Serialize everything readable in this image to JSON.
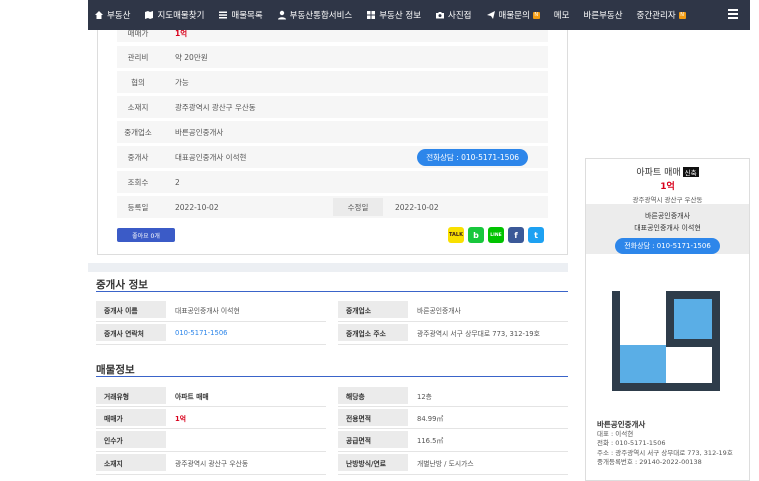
{
  "nav": {
    "items": [
      {
        "label": "부동산",
        "icon": "home-icon"
      },
      {
        "label": "지도매물찾기",
        "icon": "map-icon"
      },
      {
        "label": "매물목록",
        "icon": "list-icon"
      },
      {
        "label": "부동산통합서비스",
        "icon": "user-icon"
      },
      {
        "label": "부동산 정보",
        "icon": "grid-icon"
      },
      {
        "label": "사진접",
        "icon": "camera-icon"
      },
      {
        "label": "매물문의",
        "icon": "send-icon",
        "badge": "N"
      },
      {
        "label": "메모"
      },
      {
        "label": "바른부동산"
      },
      {
        "label": "중간관리자",
        "badge": "N"
      }
    ],
    "menu_icon": "hamburger-icon"
  },
  "detail": {
    "price_label": "매매가",
    "price_value": "1억",
    "mgmt_label": "관리비",
    "mgmt_value": "약 20만원",
    "nego_label": "협의",
    "nego_value": "가능",
    "loc_label": "소재지",
    "loc_value": "광주광역시 광산구 우산동",
    "office_label": "중개업소",
    "office_value": "바른공인중개사",
    "agent_label": "중개사",
    "agent_value": "대표공인중개사 이석현",
    "phone_label": "전화상담 : 010-5171-1506",
    "views_label": "조회수",
    "views_value": "2",
    "reg_label": "등록일",
    "reg_value": "2022-10-02",
    "mod_label": "수정일",
    "mod_value": "2022-10-02",
    "like_label": "좋아요 0개"
  },
  "share": [
    {
      "name": "kakaotalk-icon",
      "text": "TALK",
      "color": "#f9e000"
    },
    {
      "name": "band-icon",
      "text": "b",
      "color": "#18c73d"
    },
    {
      "name": "line-icon",
      "text": "LINE",
      "color": "#00c300"
    },
    {
      "name": "facebook-icon",
      "text": "f",
      "color": "#3b5998"
    },
    {
      "name": "twitter-icon",
      "text": "t",
      "color": "#1da1f2"
    }
  ],
  "agent_info": {
    "title": "중개사 정보",
    "rows": [
      [
        {
          "label": "중개사 이름",
          "value": "대표공인중개사 이석현"
        },
        {
          "label": "중개업소",
          "value": "바른공인중개사"
        }
      ],
      [
        {
          "label": "중개사 연락처",
          "value": "010-5171-1506",
          "style": "blue"
        },
        {
          "label": "중개업소 주소",
          "value": "광주광역시 서구 상무대로 773, 312-19호"
        }
      ]
    ]
  },
  "listing_info": {
    "title": "매물정보",
    "rows": [
      [
        {
          "label": "거래유형",
          "value": "아파트 매매",
          "style": "bold"
        },
        {
          "label": "해당층",
          "value": "12층"
        }
      ],
      [
        {
          "label": "매매가",
          "value": "1억",
          "style": "red"
        },
        {
          "label": "전용면적",
          "value": "84.99㎡"
        }
      ],
      [
        {
          "label": "인수가",
          "value": ""
        },
        {
          "label": "공급면적",
          "value": "116.5㎡"
        }
      ],
      [
        {
          "label": "소재지",
          "value": "광주광역시 광산구 우산동"
        },
        {
          "label": "난방방식/연료",
          "value": "개별난방 / 도시가스"
        }
      ]
    ]
  },
  "side": {
    "type": "아파트 매매",
    "new_badge": "신축",
    "price": "1억",
    "addr": "광주광역시 광산구 우산동",
    "office": "바른공인중개사",
    "agent": "대표공인중개사 이석현",
    "phone_btn": "전화상담 : 010-5171-1506",
    "info_name": "바른공인중개사",
    "info_rep": "대표 : 이석현",
    "info_tel": "전화 : 010-5171-1506",
    "info_addr": "주소 : 광주광역시 서구 상무대로 773, 312-19호",
    "info_reg": "중개등록번호 : 29140-2022-00138"
  },
  "colors": {
    "nav": "#2f3647",
    "accent": "#2d86ea",
    "price": "#d9001b"
  }
}
